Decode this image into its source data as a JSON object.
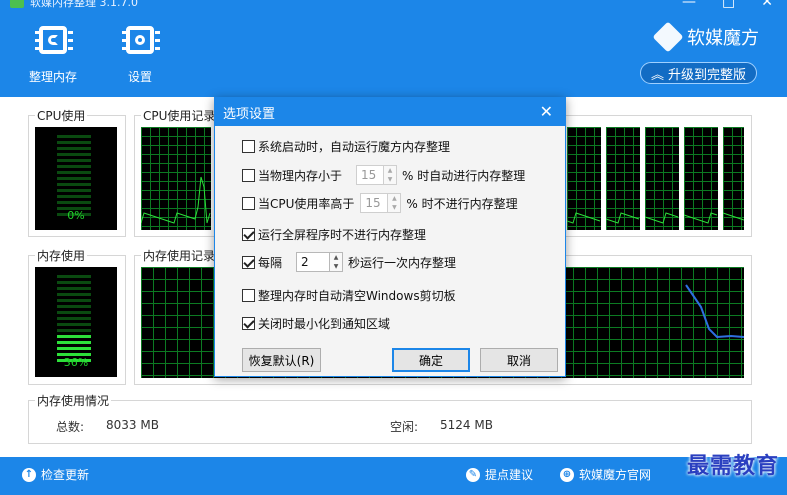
{
  "window": {
    "title": "软媒内存整理 3.1.7.0",
    "min": "—",
    "max": "□",
    "close": "✕"
  },
  "toolbar": [
    {
      "label": "整理内存",
      "icon": "memory-chip-icon"
    },
    {
      "label": "设置",
      "icon": "settings-chip-icon"
    }
  ],
  "brand": {
    "name": "软媒魔方",
    "upgrade": "升级到完整版"
  },
  "panels": {
    "cpu_usage": {
      "title": "CPU使用",
      "value": "0%",
      "level": 0
    },
    "cpu_history": {
      "title": "CPU使用记录"
    },
    "mem_usage": {
      "title": "内存使用",
      "value": "36%",
      "level": 0.36
    },
    "mem_history": {
      "title": "内存使用记录"
    },
    "mem_info": {
      "title": "内存使用情况",
      "total_label": "总数:",
      "total_value": "8033 MB",
      "free_label": "空闲:",
      "free_value": "5124 MB"
    }
  },
  "statusbar": {
    "check_update": "检查更新",
    "suggest": "提点建议",
    "website": "软媒魔方官网"
  },
  "watermark": "最需教育",
  "dialog": {
    "title": "选项设置",
    "close": "✕",
    "options": [
      {
        "label": "系统启动时，自动运行魔方内存整理",
        "checked": false
      },
      {
        "label": "当物理内存小于",
        "checked": false,
        "value": "15",
        "suffix": "% 时自动进行内存整理"
      },
      {
        "label": "当CPU使用率高于",
        "checked": false,
        "value": "15",
        "suffix": "% 时不进行内存整理"
      },
      {
        "label": "运行全屏程序时不进行内存整理",
        "checked": true
      },
      {
        "label": "每隔",
        "checked": true,
        "value": "2",
        "suffix": "秒运行一次内存整理"
      },
      {
        "label": "整理内存时自动清空Windows剪切板",
        "checked": false
      },
      {
        "label": "关闭时最小化到通知区域",
        "checked": true
      }
    ],
    "buttons": {
      "restore": "恢复默认(R)",
      "ok": "确定",
      "cancel": "取消"
    }
  },
  "colors": {
    "accent": "#1c86e8",
    "meter_on": "#2de03a",
    "grid": "#0c7a22",
    "mem_line": "#2f6fe0"
  }
}
